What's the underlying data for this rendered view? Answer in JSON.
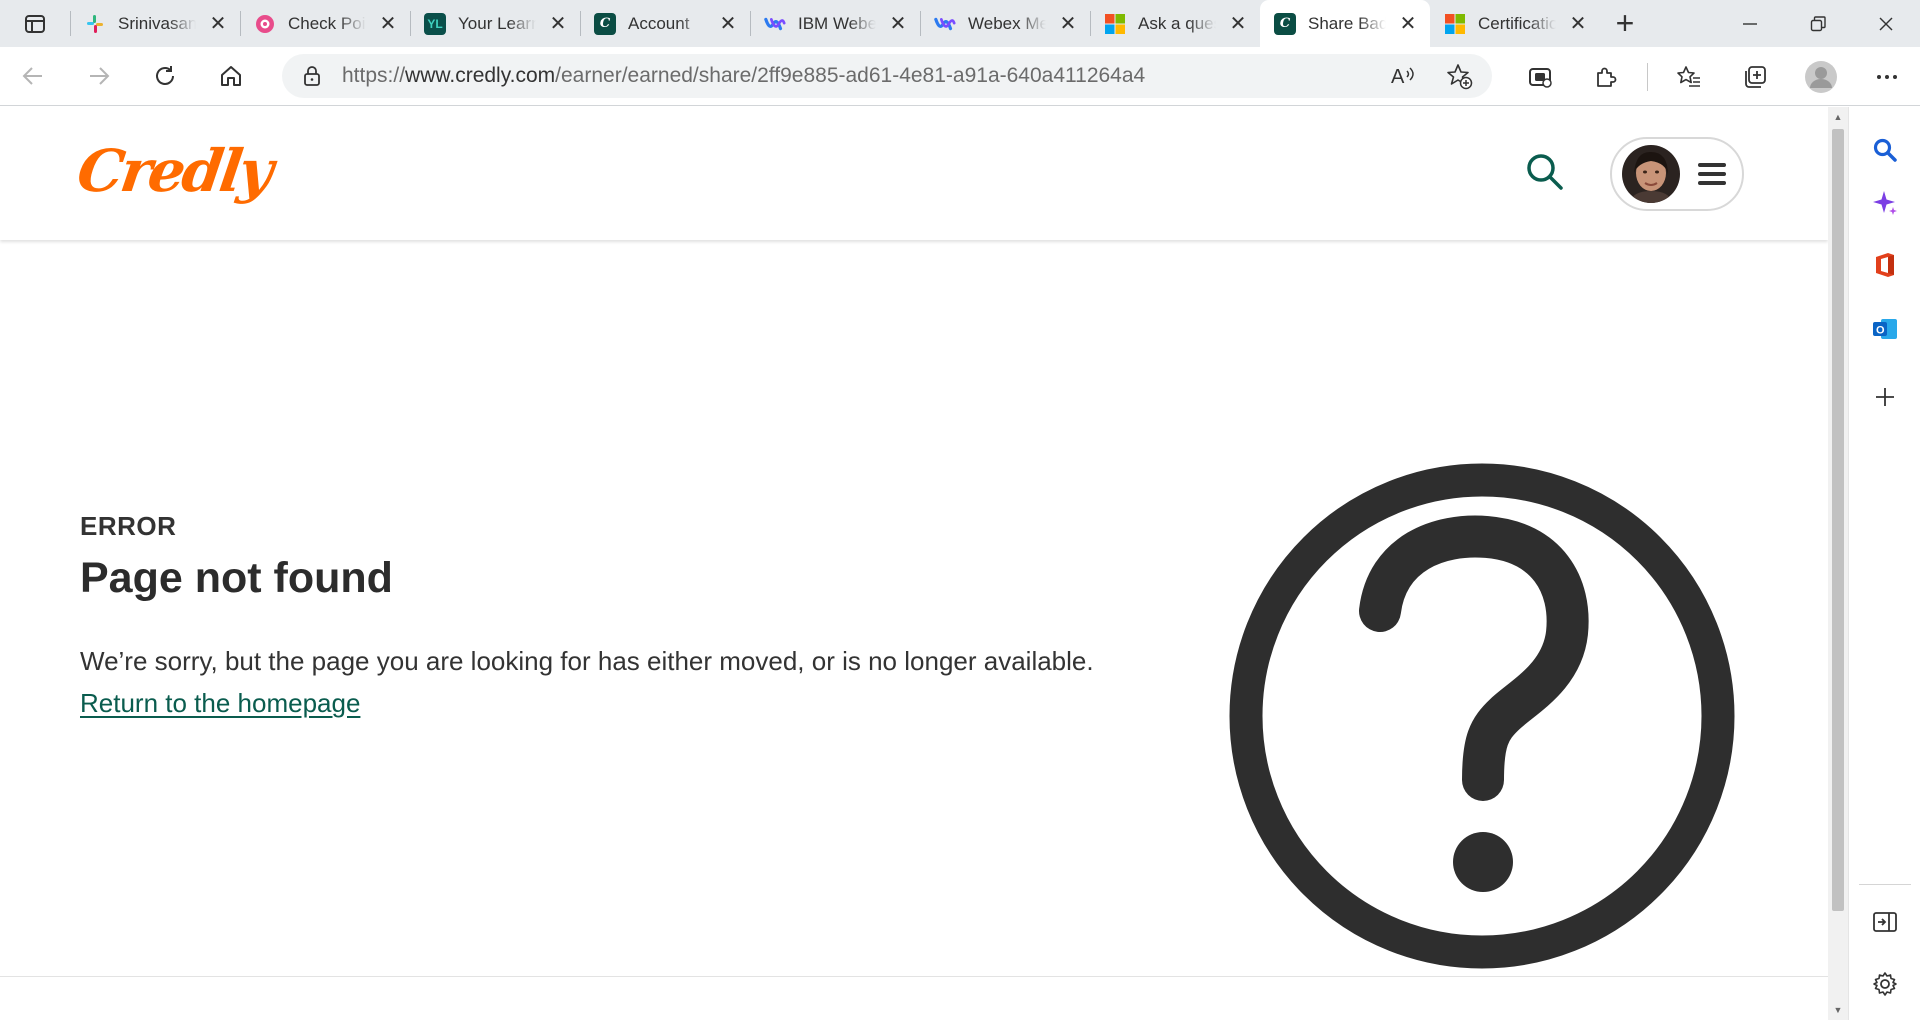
{
  "browser": {
    "tabs": [
      {
        "title": "Srinivasan",
        "favicon": "slack-icon",
        "active": false
      },
      {
        "title": "Check Point",
        "favicon": "checkpoint-icon",
        "active": false
      },
      {
        "title": "Your Learning",
        "favicon": "yl-icon",
        "active": false
      },
      {
        "title": "Account",
        "favicon": "credly-icon",
        "active": false
      },
      {
        "title": "IBM Webex",
        "favicon": "webex-icon",
        "active": false
      },
      {
        "title": "Webex Meetings",
        "favicon": "webex-icon",
        "active": false
      },
      {
        "title": "Ask a question",
        "favicon": "microsoft-icon",
        "active": false
      },
      {
        "title": "Share Badge",
        "favicon": "credly-icon",
        "active": true
      },
      {
        "title": "Certification",
        "favicon": "microsoft-icon",
        "active": false
      }
    ],
    "address_bar": {
      "url_prefix": "https://",
      "url_host": "www.credly.com",
      "url_path": "/earner/earned/share/2ff9e885-ad61-4e81-a91a-640a411264a4"
    },
    "scroll_position": 0.0
  },
  "site": {
    "logo_text": "Credly"
  },
  "error": {
    "label": "ERROR",
    "title": "Page not found",
    "message": "We’re sorry, but the page you are looking for has either moved, or is no longer available.",
    "link_text": "Return to the homepage"
  },
  "colors": {
    "brand_orange": "#ff6b00",
    "link_green": "#0a5c4e",
    "icon_dark": "#2e2e2e",
    "search_green": "#0a5c4e"
  }
}
